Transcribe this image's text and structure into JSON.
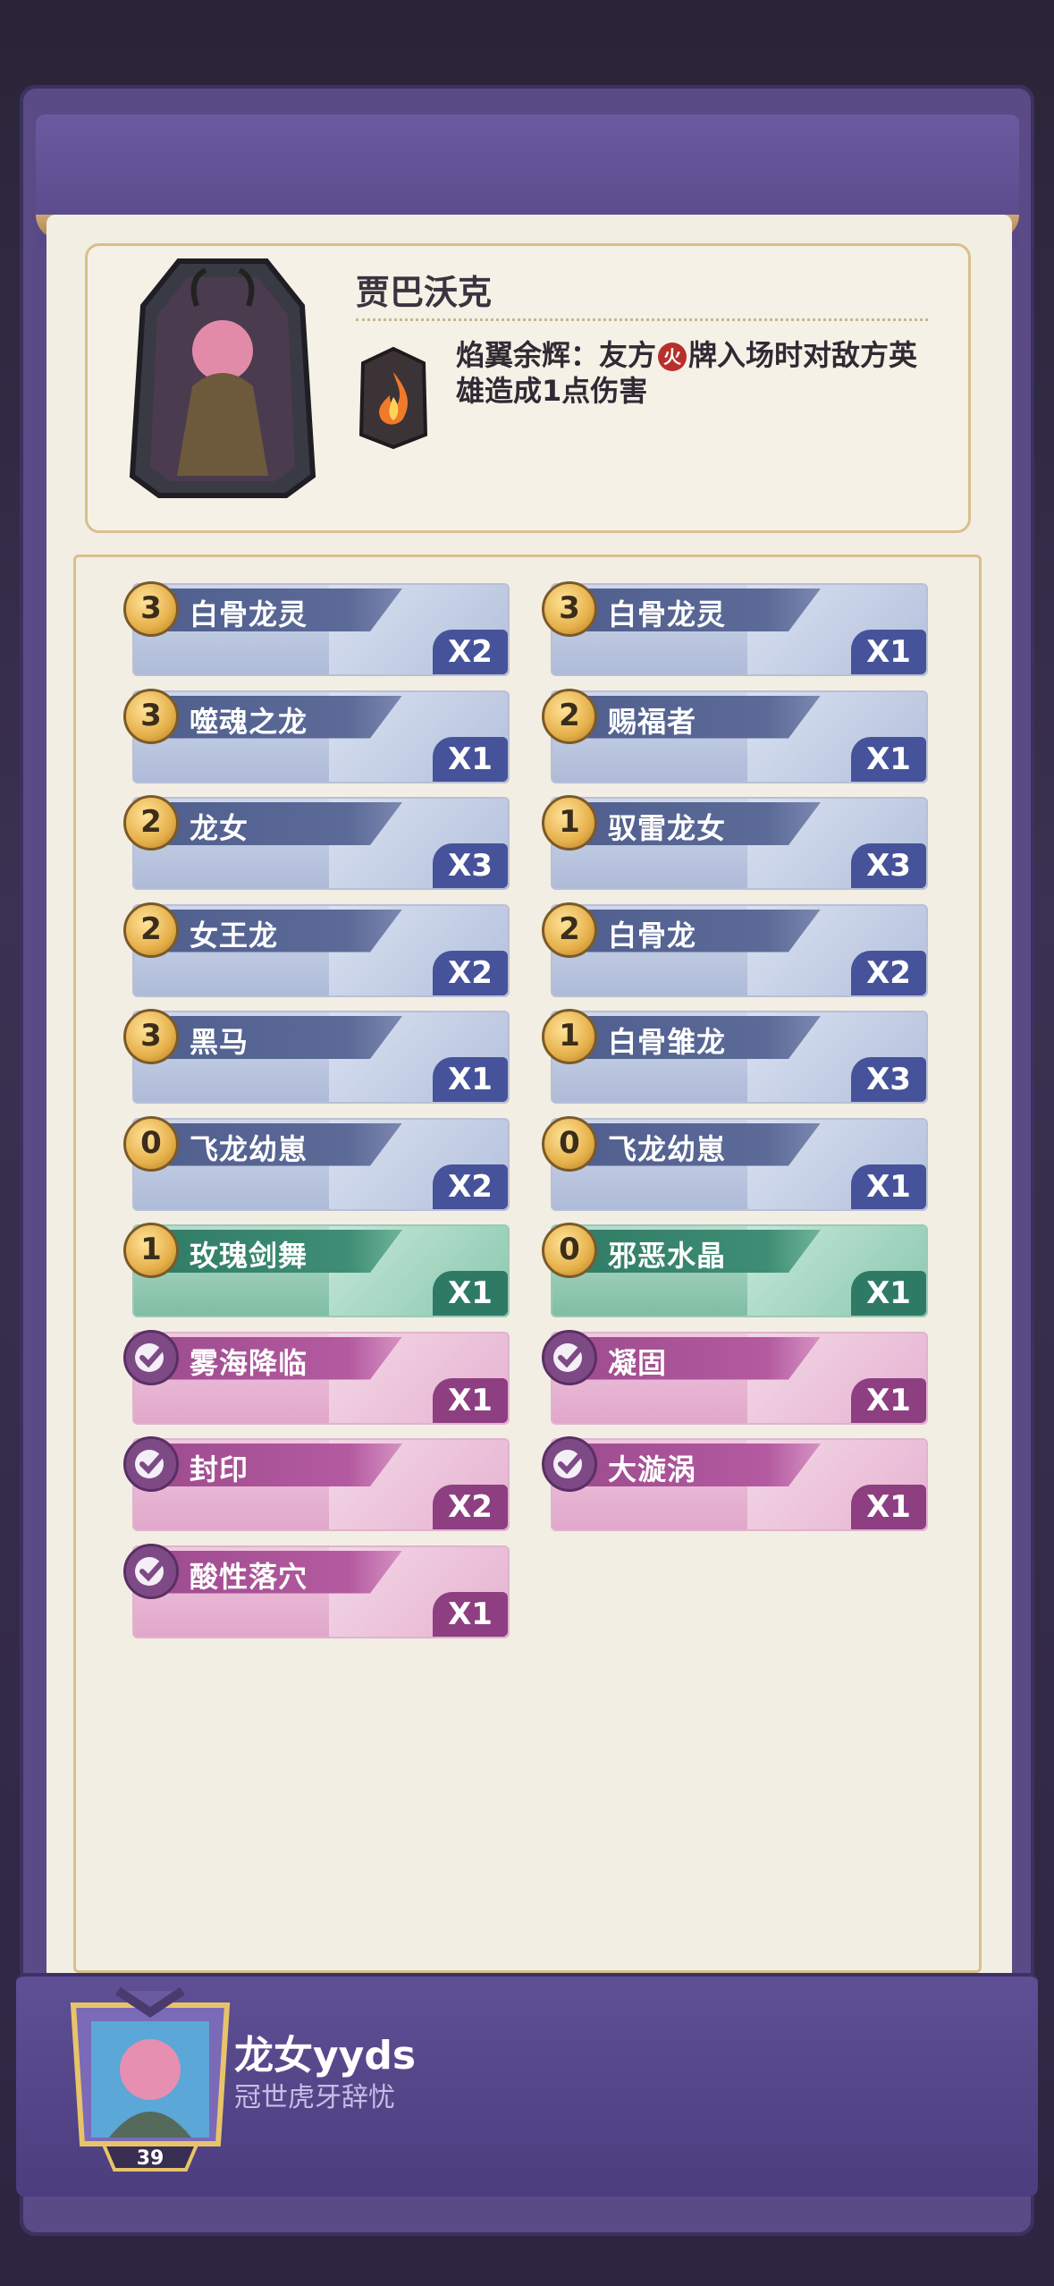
{
  "hero": {
    "name": "贾巴沃克",
    "skill_prefix": "焰翼余辉：友方",
    "skill_badge": "火",
    "skill_suffix": "牌入场时对敌方英雄造成1点伤害"
  },
  "cards": [
    {
      "cost": "3",
      "name": "白骨龙灵",
      "count": "X2",
      "type": "blue"
    },
    {
      "cost": "3",
      "name": "白骨龙灵",
      "count": "X1",
      "type": "blue"
    },
    {
      "cost": "3",
      "name": "噬魂之龙",
      "count": "X1",
      "type": "blue"
    },
    {
      "cost": "2",
      "name": "赐福者",
      "count": "X1",
      "type": "blue"
    },
    {
      "cost": "2",
      "name": "龙女",
      "count": "X3",
      "type": "blue"
    },
    {
      "cost": "1",
      "name": "驭雷龙女",
      "count": "X3",
      "type": "blue"
    },
    {
      "cost": "2",
      "name": "女王龙",
      "count": "X2",
      "type": "blue"
    },
    {
      "cost": "2",
      "name": "白骨龙",
      "count": "X2",
      "type": "blue"
    },
    {
      "cost": "3",
      "name": "黑马",
      "count": "X1",
      "type": "blue"
    },
    {
      "cost": "1",
      "name": "白骨雏龙",
      "count": "X3",
      "type": "blue"
    },
    {
      "cost": "0",
      "name": "飞龙幼崽",
      "count": "X2",
      "type": "blue"
    },
    {
      "cost": "0",
      "name": "飞龙幼崽",
      "count": "X1",
      "type": "blue"
    },
    {
      "cost": "1",
      "name": "玫瑰剑舞",
      "count": "X1",
      "type": "green"
    },
    {
      "cost": "0",
      "name": "邪恶水晶",
      "count": "X1",
      "type": "green"
    },
    {
      "cost": "",
      "name": "雾海降临",
      "count": "X1",
      "type": "pink"
    },
    {
      "cost": "",
      "name": "凝固",
      "count": "X1",
      "type": "pink"
    },
    {
      "cost": "",
      "name": "封印",
      "count": "X2",
      "type": "pink"
    },
    {
      "cost": "",
      "name": "大漩涡",
      "count": "X1",
      "type": "pink"
    },
    {
      "cost": "",
      "name": "酸性落穴",
      "count": "X1",
      "type": "pink"
    }
  ],
  "player": {
    "name": "龙女yyds",
    "title": "冠世虎牙辞忧",
    "level": "39"
  }
}
